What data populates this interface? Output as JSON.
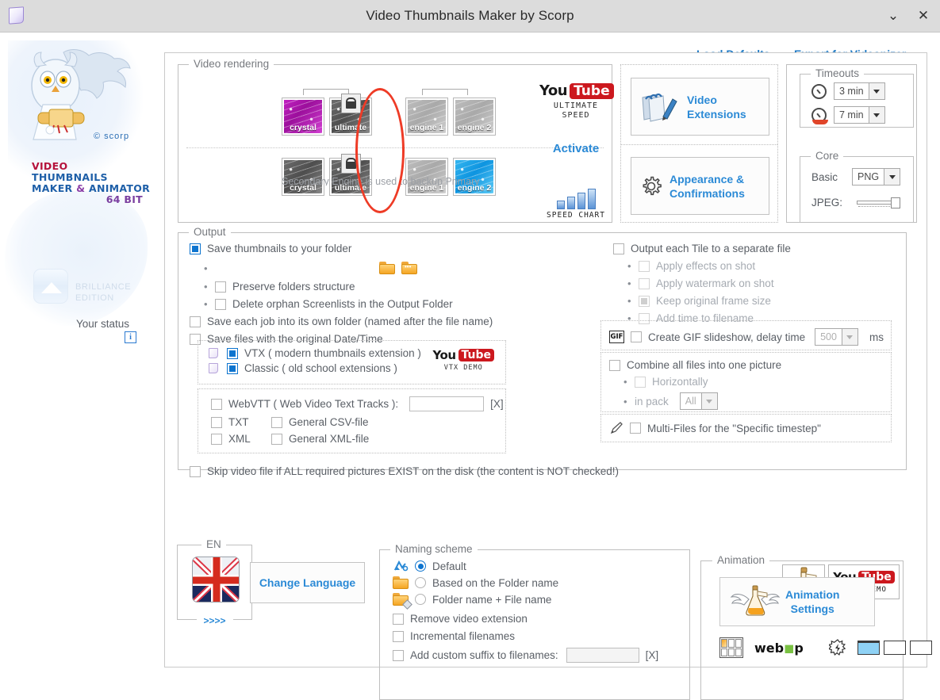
{
  "window": {
    "title": "Video Thumbnails Maker by Scorp",
    "minimize_icon": "chevron-down-icon",
    "close_icon": "close-icon",
    "app_icon": "page-logo-icon"
  },
  "branding": {
    "copyright": "© scorp",
    "line1": "VIDEO",
    "line2": "THUMBNAILS",
    "line3_a": "MAKER ",
    "line3_amp": "&",
    "line3_b": " ANIMATOR",
    "line4": "64 BIT",
    "edition_line1": "BRILLIANCE",
    "edition_line2": "EDITION",
    "your_status": "Your status",
    "status_info_glyph": "i"
  },
  "top_links": {
    "load_defaults": "Load Defaults",
    "export_for_videonizer": "Export for Videonizer"
  },
  "video_rendering": {
    "legend": "Video rendering",
    "primary_row": [
      {
        "label": "crystal",
        "state": "active-purple",
        "locked": false
      },
      {
        "label": "ultimate",
        "state": "locked-gray",
        "locked": true
      },
      {
        "label": "engine 1",
        "state": "inactive-gray",
        "locked": false
      },
      {
        "label": "engine 2",
        "state": "inactive-gray",
        "locked": false
      }
    ],
    "secondary_row": [
      {
        "label": "crystal",
        "state": "dark-gray",
        "locked": false
      },
      {
        "label": "ultimate",
        "state": "locked-gray",
        "locked": true
      },
      {
        "label": "engine 1",
        "state": "inactive-gray",
        "locked": false
      },
      {
        "label": "engine 2",
        "state": "active-blue",
        "locked": false
      }
    ],
    "hint": "Secondary Engine is used to backup Primary",
    "youtube_caption_1": "ULTIMATE",
    "youtube_caption_2": "SPEED",
    "activate": "Activate",
    "speed_chart_caption": "SPEED CHART",
    "speed_chart_bars": [
      10,
      15,
      20,
      26
    ],
    "highlight_ellipse_color": "#ee3b26"
  },
  "buttons_panel": {
    "video_extensions_l1": "Video",
    "video_extensions_l2": "Extensions",
    "appearance_l1": "Appearance &",
    "appearance_l2": "Confirmations"
  },
  "timeouts": {
    "legend": "Timeouts",
    "value_1": "3 min",
    "value_2": "7 min"
  },
  "core": {
    "legend": "Core",
    "basic_label": "Basic",
    "basic_value": "PNG",
    "jpeg_label": "JPEG:"
  },
  "output": {
    "legend": "Output",
    "save_thumbnails": "Save thumbnails to your folder",
    "save_thumbnails_checked": true,
    "preserve_folders": "Preserve folders structure",
    "delete_orphan": "Delete orphan Screenlists in the Output Folder",
    "save_each_job": "Save each job into its own folder (named after the file name)",
    "save_original_datetime": "Save files with the original Date/Time",
    "folder_icon": "folder-icon",
    "folder_browse_icon": "folder-browse-icon",
    "vtx": "VTX ( modern thumbnails extension )",
    "vtx_checked": true,
    "classic": "Classic ( old school extensions )",
    "classic_checked": true,
    "vtx_demo_caption": "VTX DEMO",
    "webvtt": "WebVTT ( Web Video Text Tracks ):",
    "webvtt_value": "",
    "webvtt_x": "[X]",
    "txt": "TXT",
    "xml": "XML",
    "general_csv": "General CSV-file",
    "general_xml": "General XML-file",
    "skip_video": "Skip video file if ALL required pictures EXIST on the disk (the content is NOT checked!)",
    "output_each_tile": "Output each Tile to a separate file",
    "apply_effects": "Apply effects on shot",
    "apply_watermark": "Apply watermark on shot",
    "keep_original_frame_size": "Keep original frame size",
    "add_time_to_filename": "Add time to filename",
    "create_gif": "Create GIF slideshow, delay time",
    "gif_delay_value": "500",
    "gif_ms": "ms",
    "gif_icon_label": "GIF",
    "combine_all": "Combine all files into one picture",
    "horizontally": "Horizontally",
    "in_pack": "in pack",
    "in_pack_value": "All",
    "multi_files": "Multi-Files for the \"Specific timestep\"",
    "pen_icon": "pen-icon"
  },
  "language": {
    "legend": "EN",
    "arrows": ">>>>",
    "change_language": "Change Language",
    "flag_icon": "uk-flag-icon"
  },
  "naming_scheme": {
    "legend": "Naming scheme",
    "default": "Default",
    "based_on_folder": "Based on the Folder name",
    "folder_plus_file": "Folder name + File name",
    "selected": "Default",
    "remove_video_extension": "Remove video extension",
    "incremental_filenames": "Incremental filenames",
    "add_custom_suffix": "Add custom suffix to filenames:",
    "custom_suffix_value": "",
    "custom_suffix_x": "[X]"
  },
  "animation": {
    "legend": "Animation",
    "settings_l1": "Animation",
    "settings_l2": "Settings",
    "flask_tab_icon": "flask-icon",
    "youtube_anim_caption": "ANIM DEMO",
    "grid_icon": "tile-grid-icon",
    "webp_label_a": "web",
    "webp_label_o": "◼",
    "webp_label_b": "p",
    "burst_icon": "burst-icon",
    "frames_selected_index": 0
  },
  "colors": {
    "accent_blue": "#2b8ad6",
    "link_blue": "#1f7ac4",
    "checkbox_blue": "#0d74cf",
    "highlight_red": "#ee3b26",
    "titlebar_bg": "#dcdcdc",
    "text_gray": "#5a5f66"
  }
}
